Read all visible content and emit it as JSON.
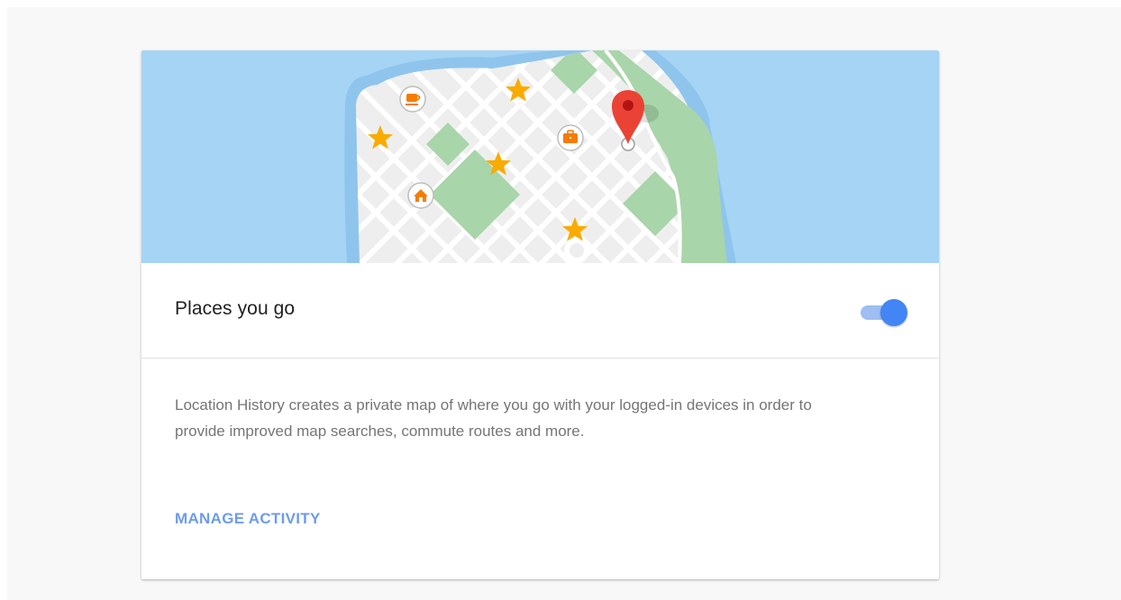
{
  "card": {
    "title": "Places you go",
    "toggle": {
      "state": "on",
      "accent_color": "#4285f4",
      "track_color": "#9fbef1"
    },
    "description": "Location History creates a private map of where you go with your logged-in devices in order to provide improved map searches, commute routes and more.",
    "manage_link": "MANAGE ACTIVITY",
    "link_color": "#6d9bef"
  },
  "illustration": {
    "icons": [
      "coffee-icon",
      "briefcase-icon",
      "home-icon",
      "star-icon",
      "location-pin-icon"
    ],
    "colors": {
      "water": "#a5d4f4",
      "land": "#eeeeee",
      "park": "#a8d5a9",
      "star": "#f9ab00",
      "pin": "#ea4335"
    }
  }
}
